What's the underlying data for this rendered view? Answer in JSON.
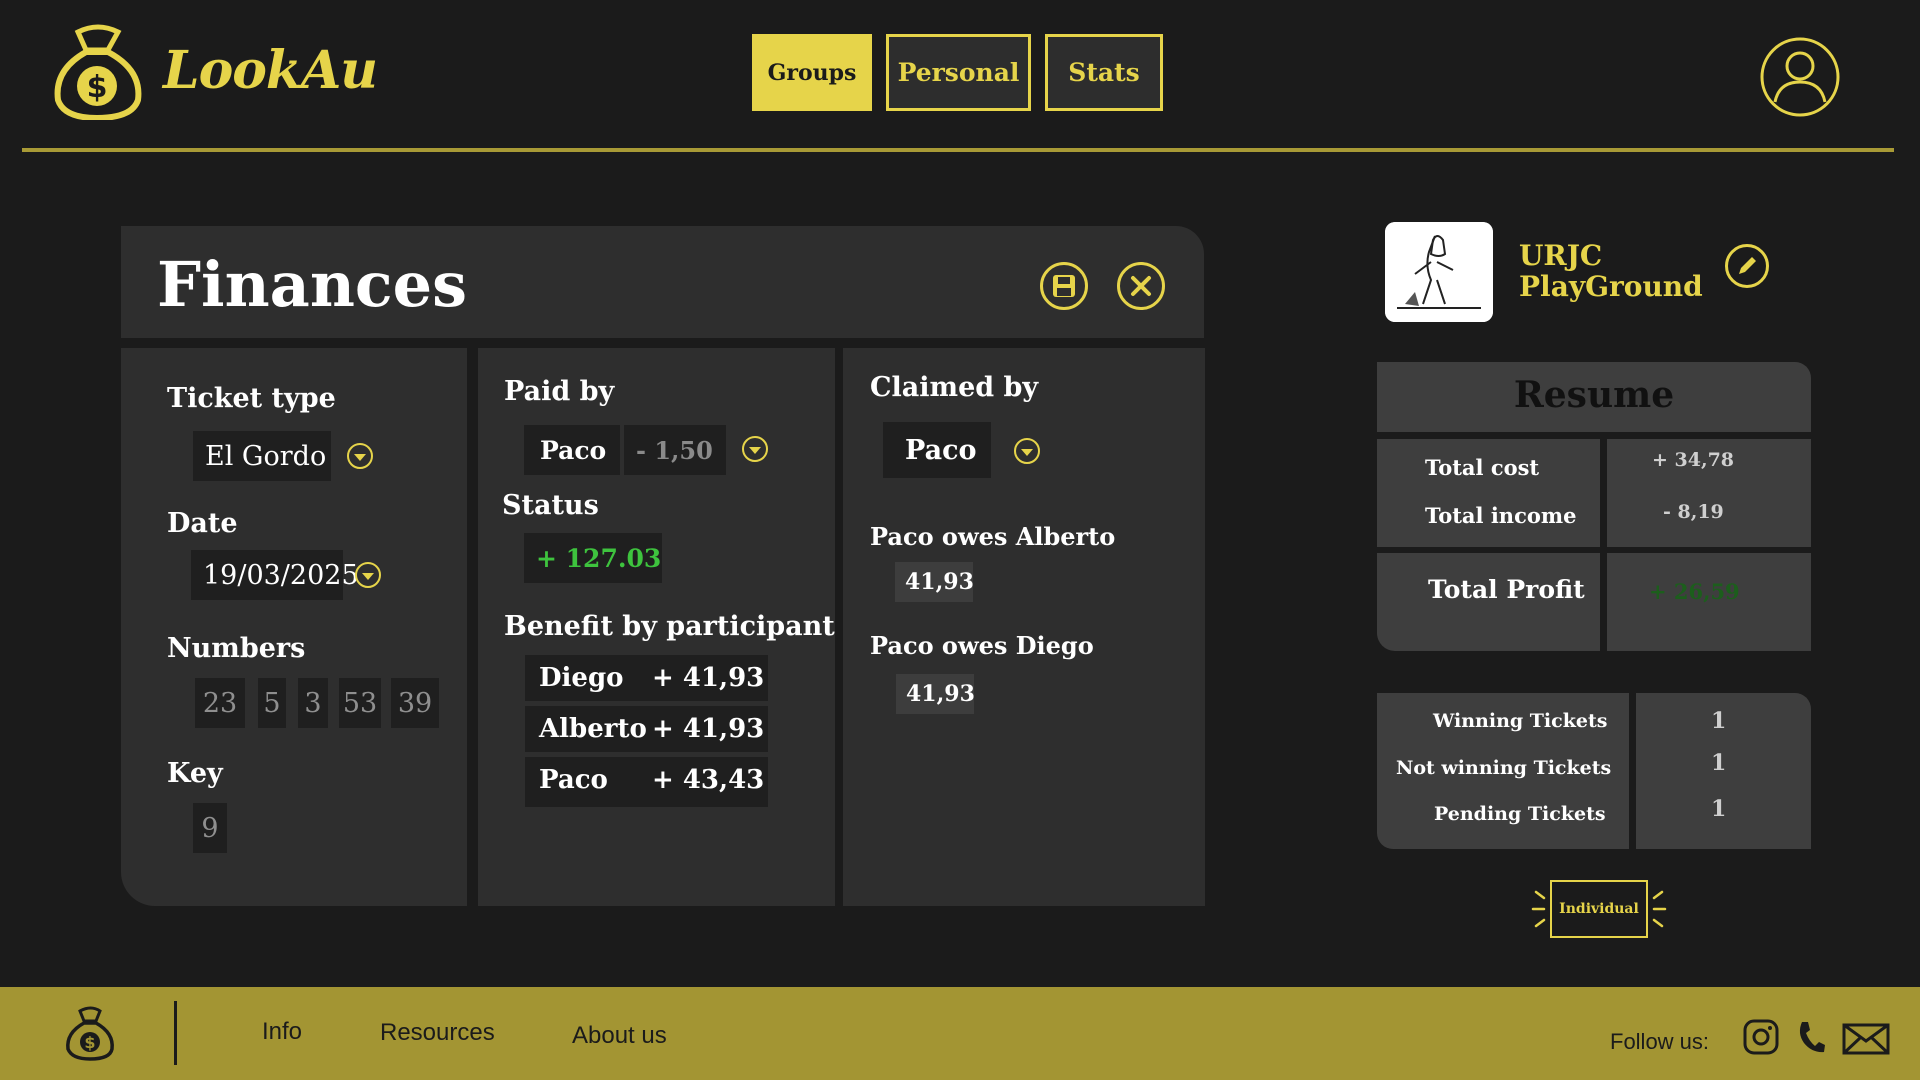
{
  "header": {
    "app_name": "LookAu",
    "nav": [
      "Groups",
      "Personal",
      "Stats"
    ],
    "active_tab": "Groups"
  },
  "finances": {
    "title": "Finances",
    "ticket_type_label": "Ticket type",
    "ticket_type_value": "El Gordo",
    "date_label": "Date",
    "date_value": "19/03/2025",
    "numbers_label": "Numbers",
    "numbers": [
      "23",
      "5",
      "3",
      "53",
      "39"
    ],
    "key_label": "Key",
    "key_value": "9",
    "paid_by_label": "Paid by",
    "paid_by_value": "Paco",
    "paid_amount": "- 1,50",
    "status_label": "Status",
    "status_value": "+ 127.03",
    "benefit_label": "Benefit by participant",
    "benefits": [
      {
        "name": "Diego",
        "value": "+ 41,93"
      },
      {
        "name": "Alberto",
        "value": "+ 41,93"
      },
      {
        "name": "Paco",
        "value": "+ 43,43"
      }
    ],
    "claimed_by_label": "Claimed by",
    "claimed_by_value": "Paco",
    "debts": [
      {
        "label": "Paco owes Alberto",
        "value": "41,93"
      },
      {
        "label": "Paco owes Diego",
        "value": "41,93"
      }
    ]
  },
  "group": {
    "name_line1": "URJC",
    "name_line2": "PlayGround"
  },
  "resume": {
    "title": "Resume",
    "total_cost_label": "Total cost",
    "total_cost_value": "+ 34,78",
    "total_income_label": "Total income",
    "total_income_value": "- 8,19",
    "total_profit_label": "Total Profit",
    "total_profit_value": "+ 26,59",
    "winning_label": "Winning Tickets",
    "winning_value": "1",
    "not_winning_label": "Not winning Tickets",
    "not_winning_value": "1",
    "pending_label": "Pending Tickets",
    "pending_value": "1"
  },
  "individual_button": "Individual",
  "footer": {
    "links": [
      "Info",
      "Resources",
      "About us"
    ],
    "follow_label": "Follow  us:"
  },
  "icons": [
    "money-bag-icon",
    "user-icon",
    "save-icon",
    "close-icon",
    "chevron-down-icon",
    "pencil-icon",
    "instagram-icon",
    "phone-icon",
    "mail-icon"
  ],
  "colors": {
    "accent": "#e6d44a",
    "background": "#1b1b1b",
    "panel": "#2e2e2e",
    "footer": "#a39533",
    "positive": "#3ec33e"
  }
}
